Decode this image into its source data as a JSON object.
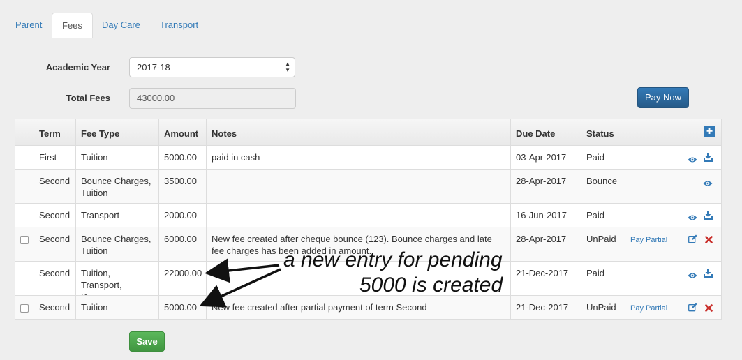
{
  "tabs": [
    {
      "label": "Parent",
      "active": false
    },
    {
      "label": "Fees",
      "active": true
    },
    {
      "label": "Day Care",
      "active": false
    },
    {
      "label": "Transport",
      "active": false
    }
  ],
  "form": {
    "academic_year_label": "Academic Year",
    "academic_year_value": "2017-18",
    "total_fees_label": "Total Fees",
    "total_fees_value": "43000.00",
    "pay_now_label": "Pay Now"
  },
  "table": {
    "headers": [
      "",
      "Term",
      "Fee Type",
      "Amount",
      "Notes",
      "Due Date",
      "Status",
      ""
    ],
    "rows": [
      {
        "checkbox": false,
        "term": "First",
        "fee_type": "Tuition",
        "amount": "5000.00",
        "notes": "paid in cash",
        "due_date": "03-Apr-2017",
        "status": "Paid",
        "pay_partial": "",
        "actions": [
          "eye-icon",
          "download-icon"
        ]
      },
      {
        "checkbox": false,
        "term": "Second",
        "fee_type": "Bounce Charges, Tuition",
        "amount": "3500.00",
        "notes": "",
        "due_date": "28-Apr-2017",
        "status": "Bounce",
        "pay_partial": "",
        "actions": [
          "eye-icon"
        ]
      },
      {
        "checkbox": false,
        "term": "Second",
        "fee_type": "Transport",
        "amount": "2000.00",
        "notes": "",
        "due_date": "16-Jun-2017",
        "status": "Paid",
        "pay_partial": "",
        "actions": [
          "eye-icon",
          "download-icon"
        ]
      },
      {
        "checkbox": true,
        "term": "Second",
        "fee_type": "Bounce Charges, Tuition",
        "amount": "6000.00",
        "notes": "New fee created after cheque bounce (123). Bounce charges and late fee charges has been added in amount.",
        "due_date": "28-Apr-2017",
        "status": "UnPaid",
        "pay_partial": "Pay Partial",
        "actions": [
          "edit-icon",
          "delete-icon"
        ]
      },
      {
        "checkbox": false,
        "term": "Second",
        "fee_type": "Tuition, Transport, Daycare",
        "amount": "22000.00",
        "notes": "",
        "due_date": "21-Dec-2017",
        "status": "Paid",
        "pay_partial": "",
        "actions": [
          "eye-icon",
          "download-icon"
        ]
      },
      {
        "checkbox": true,
        "term": "Second",
        "fee_type": "Tuition",
        "amount": "5000.00",
        "notes": "New fee created after partial payment of term Second",
        "due_date": "21-Dec-2017",
        "status": "UnPaid",
        "pay_partial": "Pay Partial",
        "actions": [
          "edit-icon",
          "delete-icon"
        ]
      }
    ]
  },
  "save_label": "Save",
  "annotation": {
    "line1": "a new entry for pending",
    "line2": "5000 is created"
  },
  "colors": {
    "link": "#337ab7",
    "delete": "#c9302c",
    "primary": "#337ab7",
    "success": "#5cb85c"
  }
}
